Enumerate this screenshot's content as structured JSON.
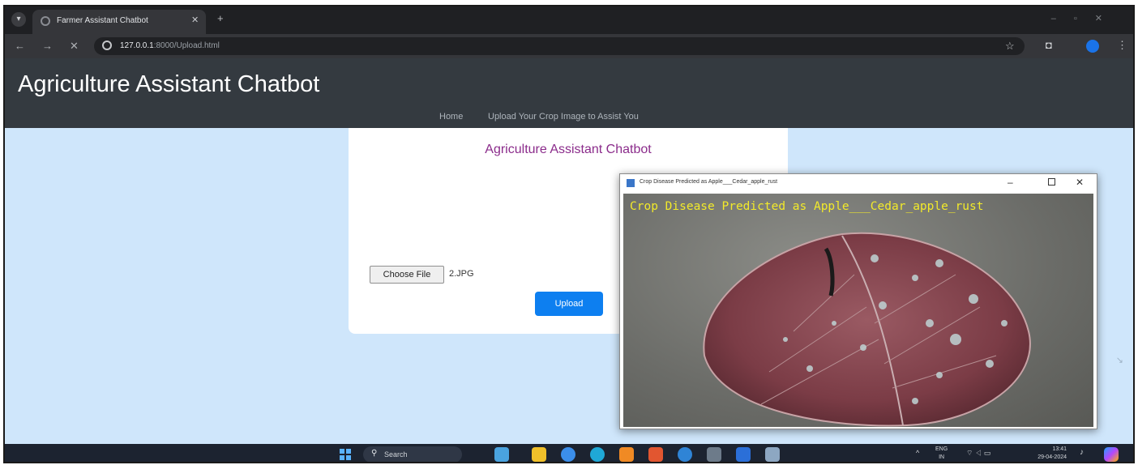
{
  "browser": {
    "tab_title": "Farmer Assistant Chatbot",
    "url_host": "127.0.0.1",
    "url_path": ":8000/Upload.html"
  },
  "header": {
    "title": "Agriculture Assistant Chatbot",
    "nav": {
      "home": "Home",
      "upload": "Upload Your Crop Image to Assist You"
    }
  },
  "card": {
    "title": "Agriculture Assistant Chatbot",
    "choose_file_label": "Choose File",
    "file_name": "2.JPG",
    "upload_label": "Upload"
  },
  "cv_window": {
    "title": "Crop Disease Predicted as Apple___Cedar_apple_rust",
    "overlay_text": "Crop Disease Predicted as Apple___Cedar_apple_rust"
  },
  "taskbar": {
    "search_label": "Search",
    "lang_line1": "ENG",
    "lang_line2": "IN",
    "time": "13:41",
    "date": "29-04-2024"
  },
  "colors": {
    "header_bg": "#343a40",
    "page_bg": "#cfe6fb",
    "card_title": "#8b2c8b",
    "upload_button": "#0d7ff0",
    "overlay_text": "#f2ea2a"
  }
}
